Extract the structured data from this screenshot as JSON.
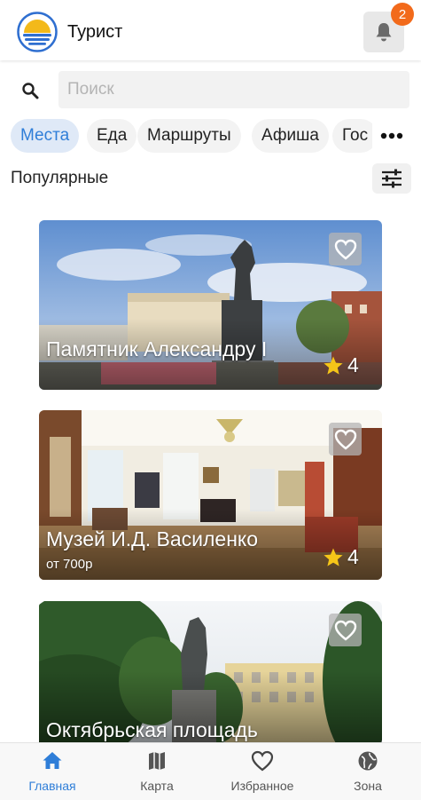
{
  "header": {
    "title": "Турист",
    "notification_count": "2"
  },
  "search": {
    "placeholder": "Поиск",
    "value": ""
  },
  "tabs": [
    {
      "label": "Места",
      "active": true
    },
    {
      "label": "Еда",
      "active": false
    },
    {
      "label": "Маршруты",
      "active": false
    },
    {
      "label": "Афиша",
      "active": false
    },
    {
      "label": "Гос",
      "active": false
    }
  ],
  "section": {
    "title": "Популярные"
  },
  "cards": [
    {
      "title": "Памятник Александру I",
      "price": "",
      "rating": "4"
    },
    {
      "title": "Музей И.Д. Василенко",
      "price": "от 700р",
      "rating": "4"
    },
    {
      "title": "Октябрьская площадь",
      "price": "",
      "rating": ""
    }
  ],
  "bottom_nav": [
    {
      "label": "Главная",
      "icon": "home-icon",
      "active": true
    },
    {
      "label": "Карта",
      "icon": "map-icon",
      "active": false
    },
    {
      "label": "Избранное",
      "icon": "heart-icon",
      "active": false
    },
    {
      "label": "Зона",
      "icon": "globe-icon",
      "active": false
    }
  ],
  "colors": {
    "accent": "#2f7ed8",
    "badge": "#f26a1b",
    "star": "#f5c518"
  }
}
